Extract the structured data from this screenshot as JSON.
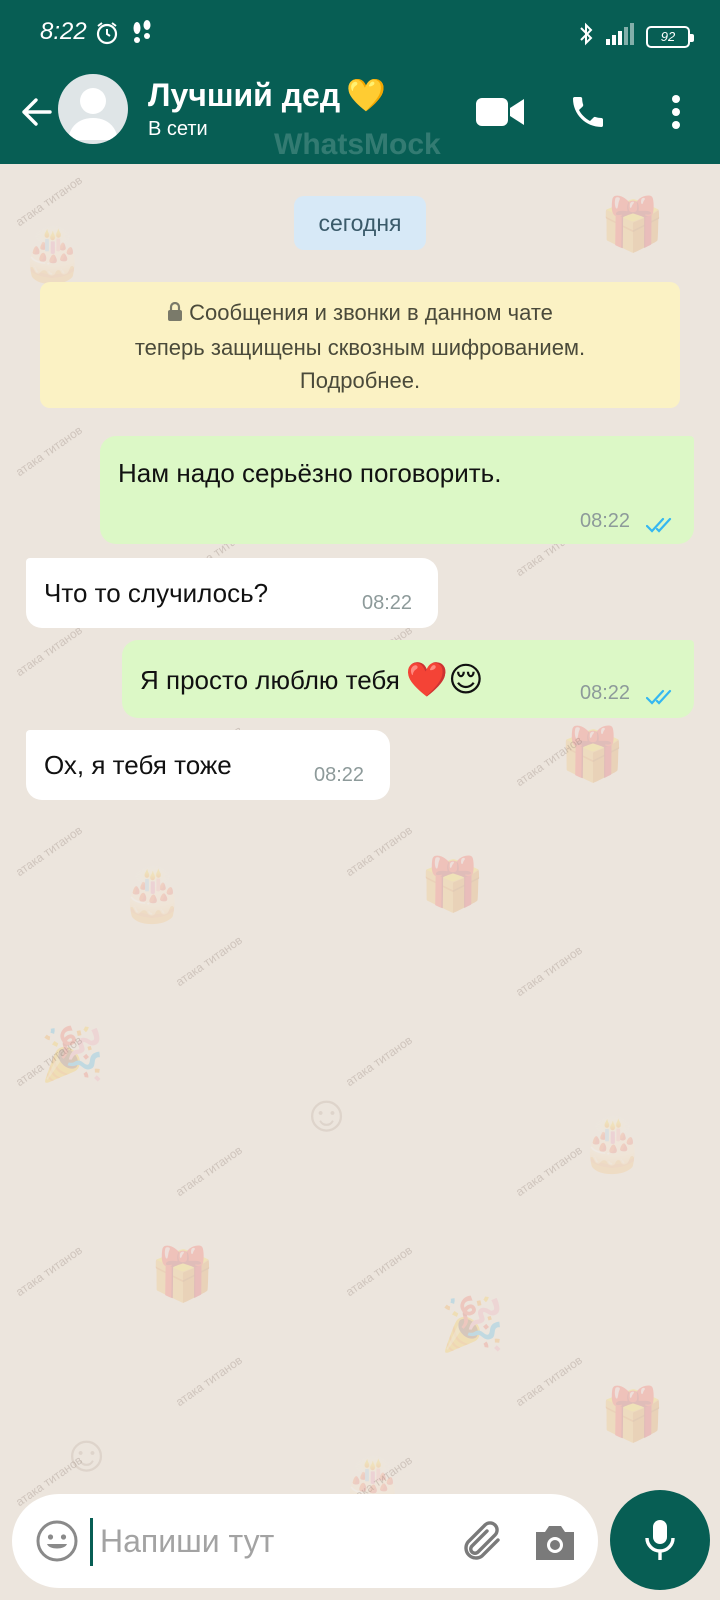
{
  "status_bar": {
    "time": "8:22",
    "battery": "92"
  },
  "header": {
    "contact_name": "Лучший дед",
    "contact_emoji": "💛",
    "contact_status": "В сети",
    "brand_watermark": "WhatsMock",
    "icons": [
      "back-arrow-icon",
      "avatar-placeholder",
      "video-call-icon",
      "phone-icon",
      "more-vert-icon"
    ]
  },
  "chat": {
    "date_chip": "сегодня",
    "encryption_notice": {
      "line1": "Сообщения и звонки в данном чате",
      "line2": "теперь защищены сквозным шифрованием.",
      "line3": "Подробнее."
    },
    "watermark_text": "атака титанов",
    "messages": [
      {
        "direction": "out",
        "text": "Нам надо серьёзно поговорить.",
        "time": "08:22",
        "read": true
      },
      {
        "direction": "in",
        "text": "Что то случилось?",
        "time": "08:22"
      },
      {
        "direction": "out",
        "text": "Я просто люблю тебя",
        "emojis": "❤️😌",
        "time": "08:22",
        "read": true
      },
      {
        "direction": "in",
        "text": "Ох, я тебя тоже",
        "time": "08:22"
      }
    ]
  },
  "input": {
    "placeholder": "Напиши тут",
    "value": ""
  },
  "colors": {
    "header": "#075e54",
    "chat_bg": "#ece5dd",
    "outgoing_bubble": "#dcf8c6",
    "incoming_bubble": "#ffffff",
    "read_ticks": "#34b7f1",
    "notice_bg": "#fbf2c4",
    "date_chip_bg": "#d7e9f7"
  }
}
